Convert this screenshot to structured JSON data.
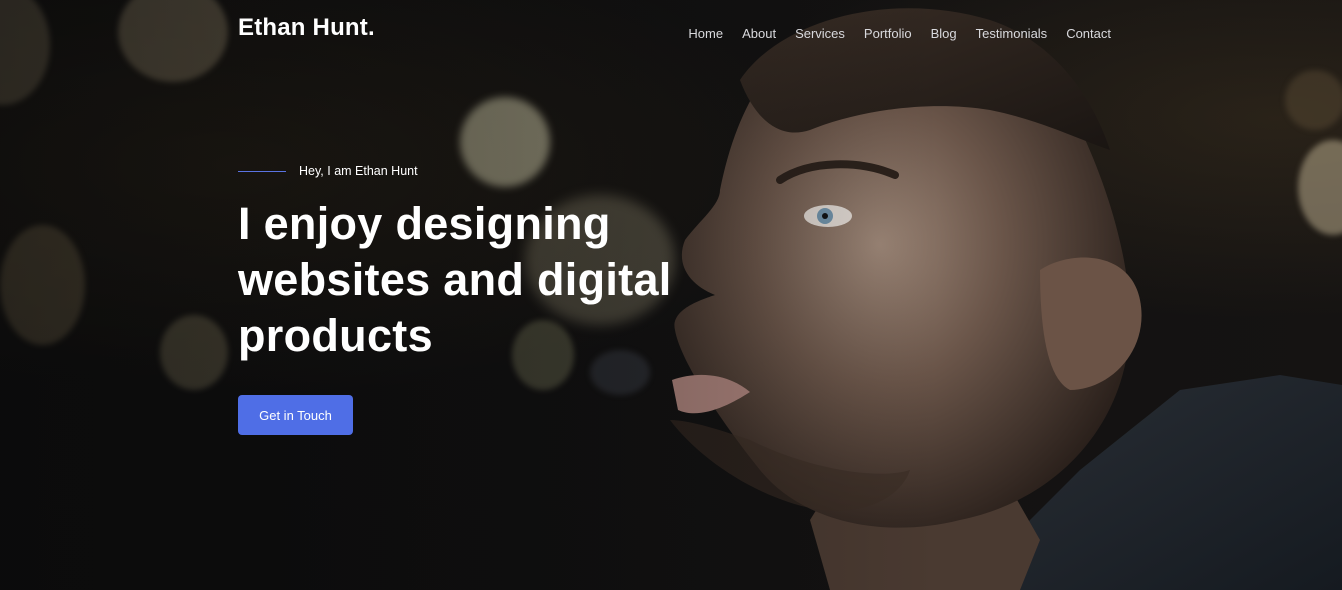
{
  "header": {
    "logo": "Ethan Hunt.",
    "nav": [
      "Home",
      "About",
      "Services",
      "Portfolio",
      "Blog",
      "Testimonials",
      "Contact"
    ]
  },
  "hero": {
    "eyebrow": "Hey, I am Ethan Hunt",
    "headline": "I enjoy designing websites and digital products",
    "cta_label": "Get in Touch"
  },
  "colors": {
    "accent": "#4f6ee6",
    "background": "#0b0b0c",
    "text": "#ffffff"
  }
}
